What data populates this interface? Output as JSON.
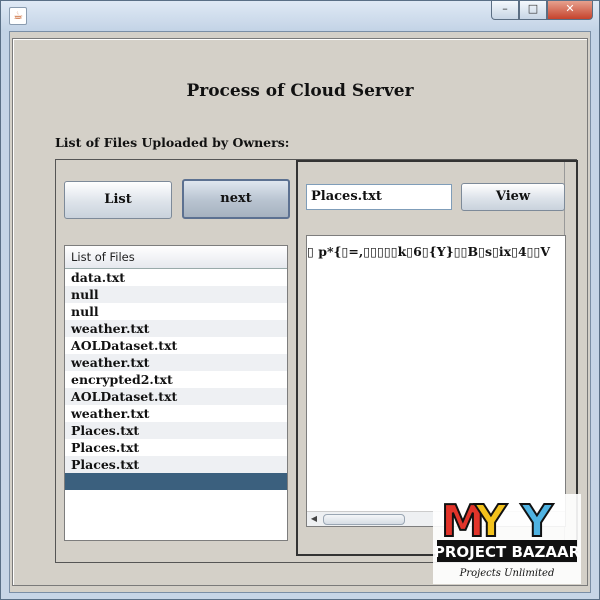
{
  "window": {
    "icon": "java-icon",
    "minimize": "–",
    "maximize": "□",
    "close": "✕"
  },
  "header": {
    "title": "Process of Cloud Server",
    "subtitle": "List of Files Uploaded by Owners:"
  },
  "buttons": {
    "list": "List",
    "next": "next",
    "view": "View"
  },
  "file_list": {
    "header": "List of Files",
    "items": [
      "data.txt",
      "null",
      "null",
      "weather.txt",
      "AOLDataset.txt",
      "weather.txt",
      "encrypted2.txt",
      "AOLDataset.txt",
      "weather.txt",
      "Places.txt",
      "Places.txt",
      "Places.txt",
      ""
    ],
    "selected_index": 12
  },
  "file_field": {
    "value": "Places.txt"
  },
  "content": {
    "text": "▯ p*{▯=,▯▯▯▯▯k▯6▯{Y}▯▯B▯s▯ix▯4▯▯V"
  },
  "logo": {
    "top": "MY",
    "middle": "PROJECT BAZAAR",
    "tagline": "Projects Unlimited"
  }
}
